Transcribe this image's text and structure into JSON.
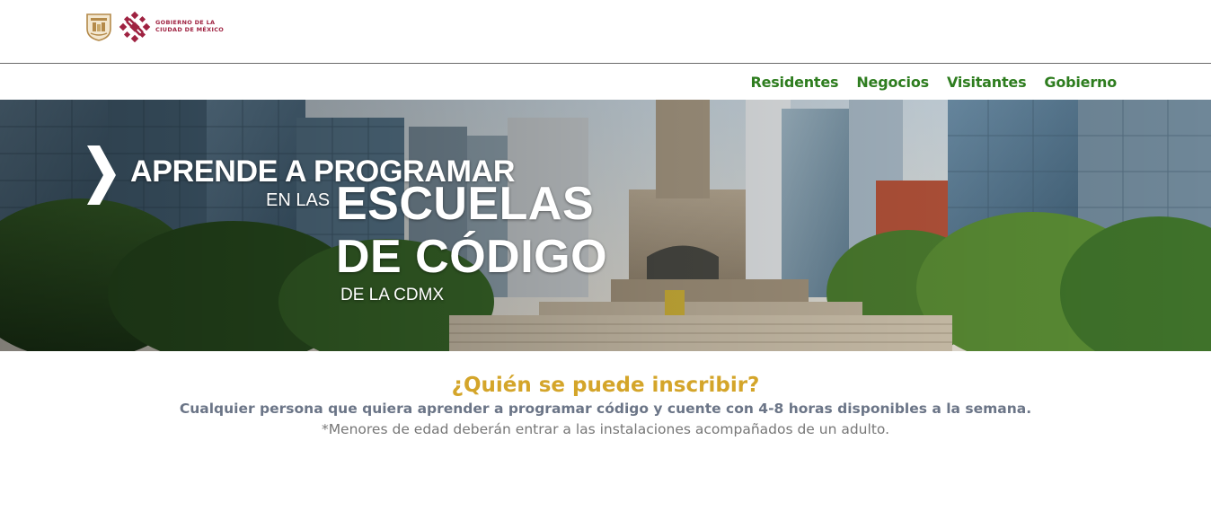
{
  "header": {
    "logo": {
      "line1": "GOBIERNO DE LA",
      "line2": "CIUDAD DE MÉXICO",
      "brand_color": "#9f2241",
      "crest_color": "#b48a4a"
    }
  },
  "nav": {
    "items": [
      {
        "label": "Residentes"
      },
      {
        "label": "Negocios"
      },
      {
        "label": "Visitantes"
      },
      {
        "label": "Gobierno"
      }
    ],
    "color": "#2e7d1f"
  },
  "banner": {
    "line1": "APRENDE A PROGRAMAR",
    "line2": "EN LAS",
    "line3": "ESCUELAS",
    "line4": "DE CÓDIGO",
    "line5": "DE LA CDMX"
  },
  "info": {
    "heading": "¿Quién se puede inscribir?",
    "text": "Cualquier persona que quiera aprender a programar código y cuente con 4-8 horas disponibles a la semana.",
    "note": "*Menores de edad deberán entrar a las instalaciones acompañados de un adulto.",
    "heading_color": "#d4a52a"
  }
}
